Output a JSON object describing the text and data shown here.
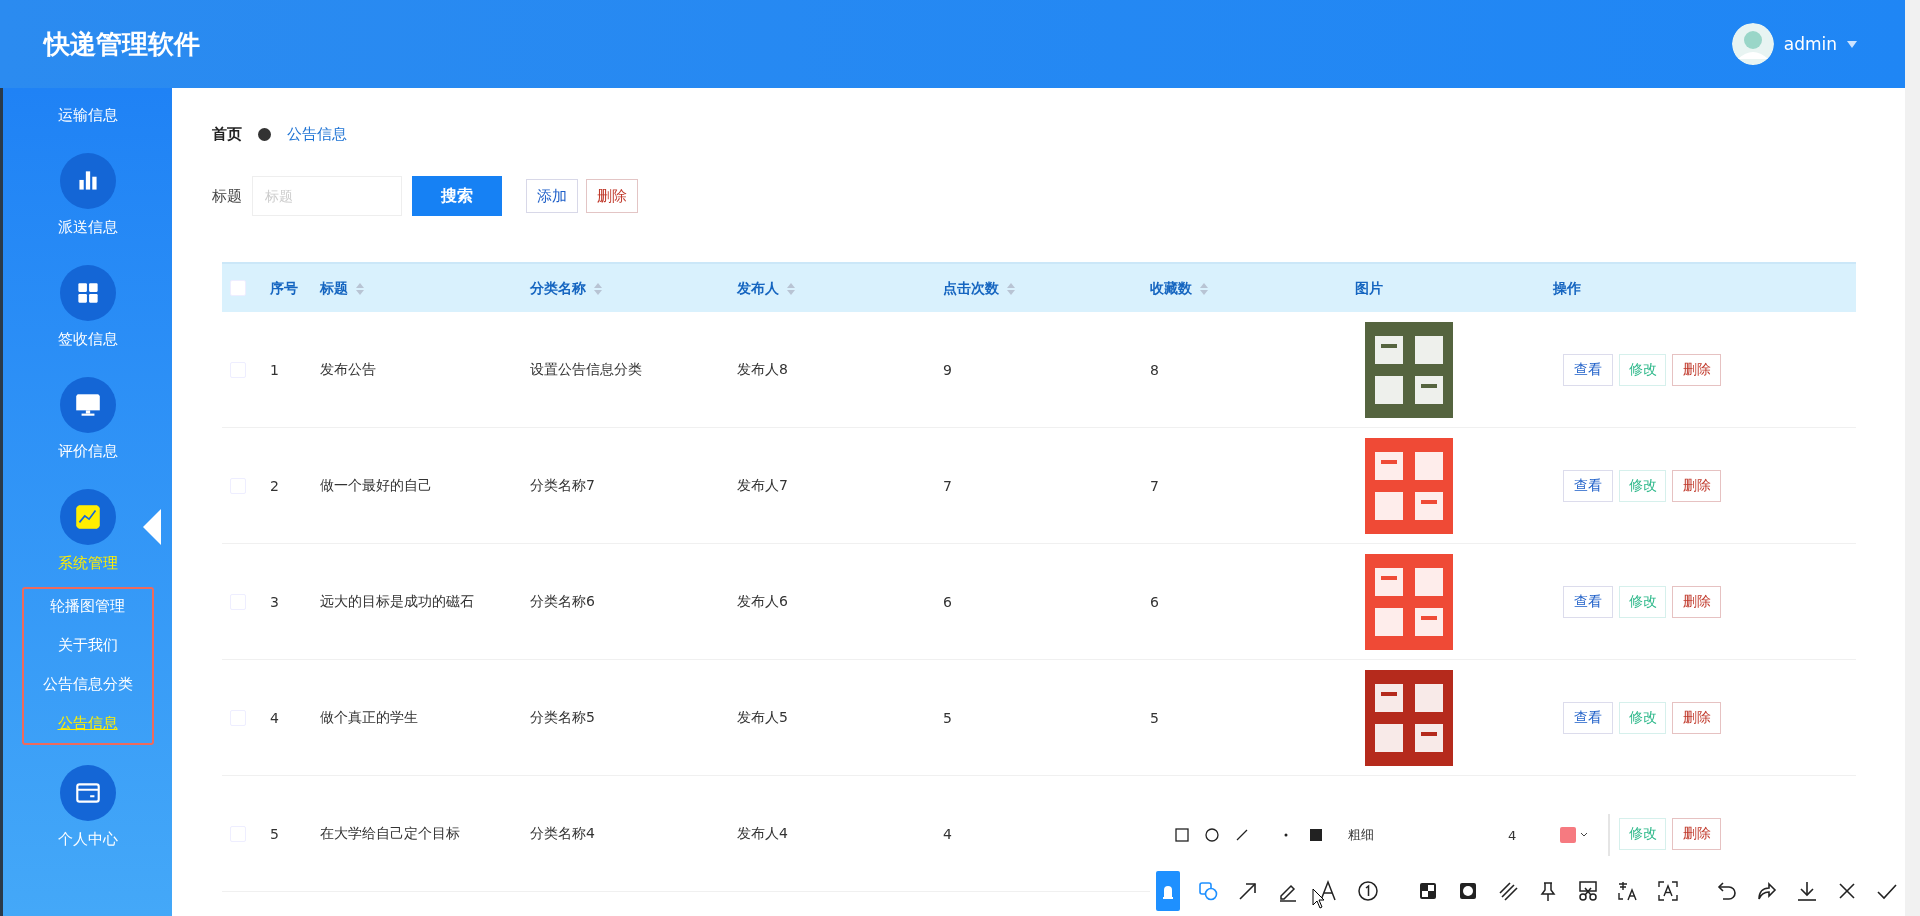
{
  "header": {
    "title": "快递管理软件",
    "user": "admin"
  },
  "sidebar": {
    "items": [
      {
        "label": "运输信息",
        "selected": false
      },
      {
        "label": "派送信息",
        "selected": false
      },
      {
        "label": "签收信息",
        "selected": false
      },
      {
        "label": "评价信息",
        "selected": false
      },
      {
        "label": "系统管理",
        "selected": true,
        "expanded": true,
        "children": [
          {
            "label": "轮播图管理",
            "selected": false
          },
          {
            "label": "关于我们",
            "selected": false
          },
          {
            "label": "公告信息分类",
            "selected": false
          },
          {
            "label": "公告信息",
            "selected": true
          }
        ]
      },
      {
        "label": "个人中心",
        "selected": false
      }
    ]
  },
  "breadcrumb": [
    "首页",
    "公告信息"
  ],
  "search": {
    "label": "标题",
    "placeholder": "标题",
    "search_button": "搜索",
    "add_button": "添加",
    "delete_button": "删除"
  },
  "table": {
    "all_checked": false,
    "columns": [
      {
        "label": "序号",
        "sortable": false
      },
      {
        "label": "标题",
        "sortable": true
      },
      {
        "label": "分类名称",
        "sortable": true
      },
      {
        "label": "发布人",
        "sortable": true
      },
      {
        "label": "点击次数",
        "sortable": true
      },
      {
        "label": "收藏数",
        "sortable": true
      },
      {
        "label": "图片",
        "sortable": false
      },
      {
        "label": "操作",
        "sortable": false
      }
    ],
    "rows": [
      {
        "checked": false,
        "no": "1",
        "title": "发布公告",
        "category": "设置公告信息分类",
        "publisher": "发布人8",
        "clicks": "9",
        "favorites": "8",
        "image": {
          "kind": "picture",
          "color": "#55643f"
        },
        "actions": [
          {
            "kind": "view",
            "label": "查看"
          },
          {
            "kind": "edit",
            "label": "修改"
          },
          {
            "kind": "delete",
            "label": "删除"
          }
        ]
      },
      {
        "checked": false,
        "no": "2",
        "title": "做一个最好的自己",
        "category": "分类名称7",
        "publisher": "发布人7",
        "clicks": "7",
        "favorites": "7",
        "image": {
          "kind": "picture",
          "color": "#ef4a36"
        },
        "actions": [
          {
            "kind": "view",
            "label": "查看"
          },
          {
            "kind": "edit",
            "label": "修改"
          },
          {
            "kind": "delete",
            "label": "删除"
          }
        ]
      },
      {
        "checked": false,
        "no": "3",
        "title": "远大的目标是成功的磁石",
        "category": "分类名称6",
        "publisher": "发布人6",
        "clicks": "6",
        "favorites": "6",
        "image": {
          "kind": "picture",
          "color": "#ef4a36"
        },
        "actions": [
          {
            "kind": "view",
            "label": "查看"
          },
          {
            "kind": "edit",
            "label": "修改"
          },
          {
            "kind": "delete",
            "label": "删除"
          }
        ]
      },
      {
        "checked": false,
        "no": "4",
        "title": "做个真正的学生",
        "category": "分类名称5",
        "publisher": "发布人5",
        "clicks": "5",
        "favorites": "5",
        "image": {
          "kind": "picture",
          "color": "#b52a1c"
        },
        "actions": [
          {
            "kind": "view",
            "label": "查看"
          },
          {
            "kind": "edit",
            "label": "修改"
          },
          {
            "kind": "delete",
            "label": "删除"
          }
        ]
      },
      {
        "checked": false,
        "no": "5",
        "title": "在大学给自己定个目标",
        "category": "分类名称4",
        "publisher": "发布人4",
        "clicks": "4",
        "actions": [
          {
            "kind": "edit",
            "label": "修改"
          },
          {
            "kind": "delete",
            "label": "删除"
          }
        ]
      }
    ]
  },
  "screenshot_toolbar": {
    "thickness_label": "粗细",
    "thickness": "4",
    "color": "#f67a80",
    "tools": [
      {
        "selected": true
      },
      {
        "selected": false
      },
      {
        "selected": false
      },
      {
        "selected": false
      },
      {
        "selected": false
      },
      {
        "selected": false
      },
      {
        "selected": false
      },
      {
        "selected": false
      },
      {
        "selected": false
      },
      {
        "selected": false
      },
      {
        "selected": false
      },
      {
        "selected": false
      },
      {
        "selected": false
      },
      {
        "selected": false
      },
      {
        "selected": false
      },
      {
        "selected": false
      },
      {
        "selected": false
      },
      {
        "selected": false
      }
    ]
  }
}
